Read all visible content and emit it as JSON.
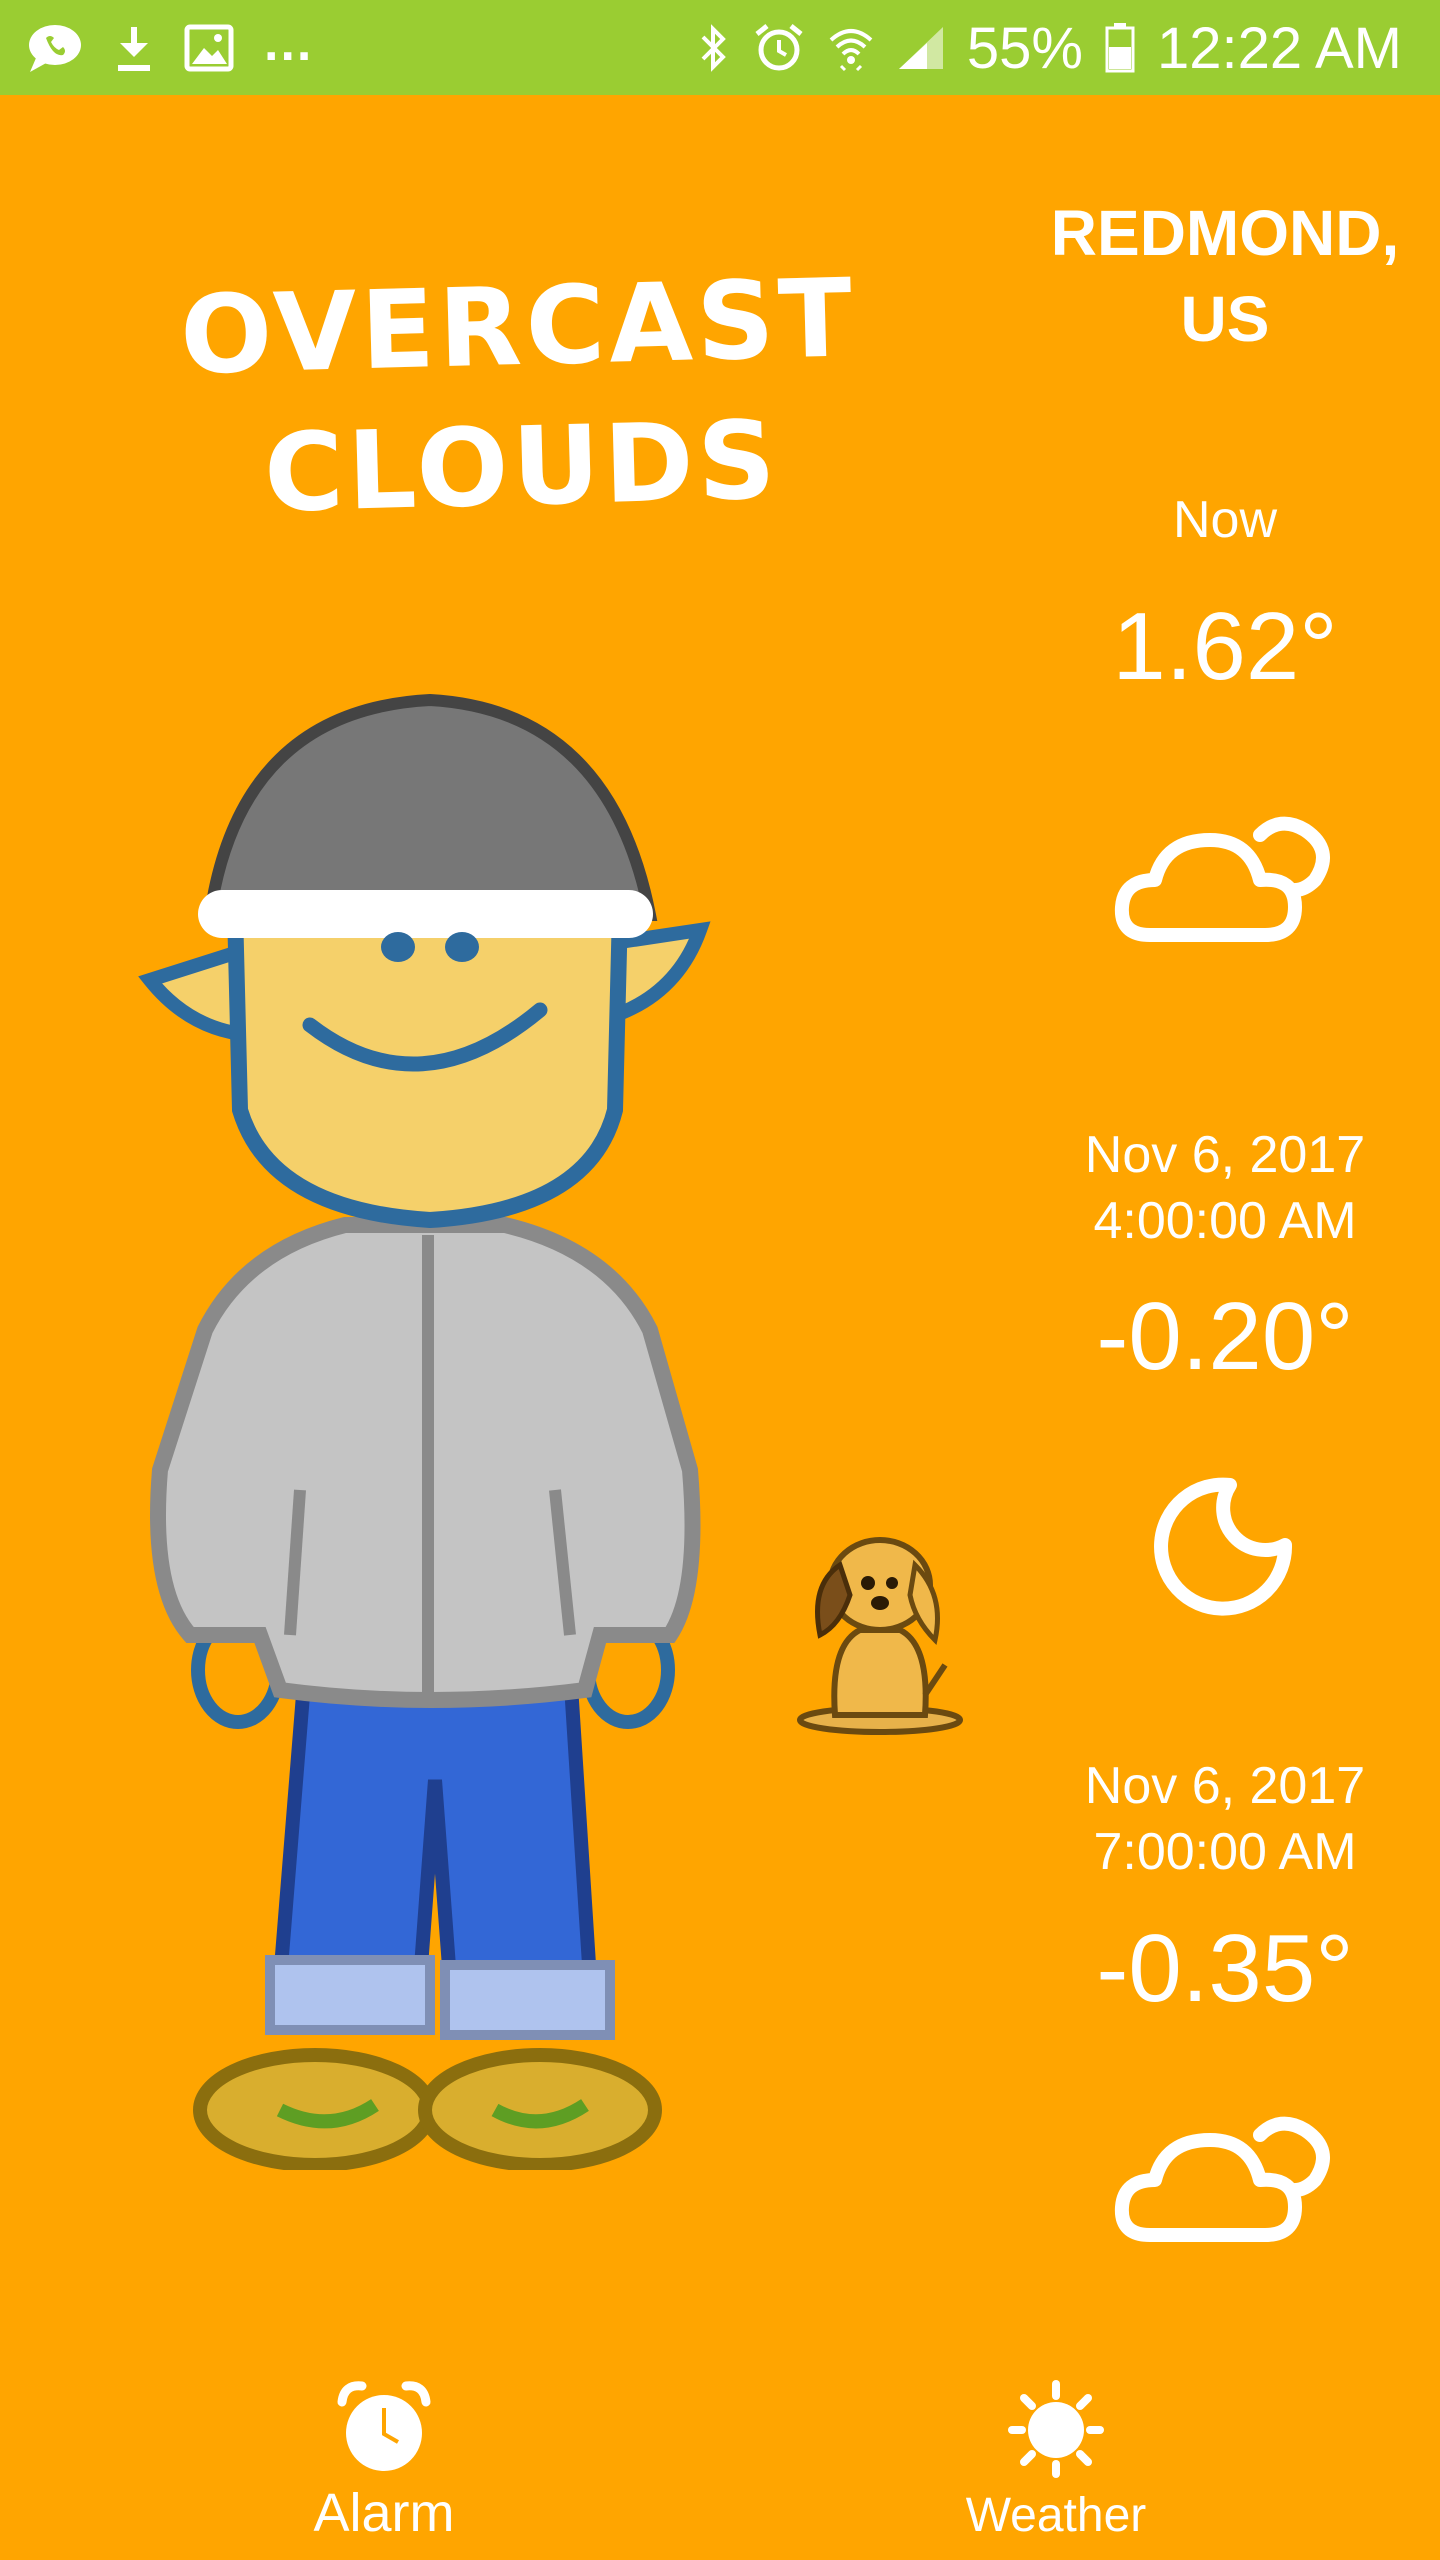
{
  "status_bar": {
    "battery": "55%",
    "time": "12:22 AM",
    "more": "...",
    "icons": [
      "chat-icon",
      "download-icon",
      "image-icon",
      "bluetooth-icon",
      "alarm-icon",
      "wifi-icon",
      "signal-icon",
      "battery-icon"
    ]
  },
  "weather": {
    "condition": "OVERCAST\nCLOUDS",
    "location": "REDMOND,\nUS",
    "forecast": [
      {
        "label": "Now",
        "temp": "1.62°",
        "icon": "cloud-icon"
      },
      {
        "label": "Nov 6, 2017\n4:00:00 AM",
        "temp": "-0.20°",
        "icon": "moon-icon"
      },
      {
        "label": "Nov 6, 2017\n7:00:00 AM",
        "temp": "-0.35°",
        "icon": "cloud-icon"
      }
    ]
  },
  "bottom_nav": {
    "alarm_label": "Alarm",
    "weather_label": "Weather"
  },
  "colors": {
    "background": "#FFA500",
    "status_bar": "#9ACD32",
    "text": "#FFFFFF"
  }
}
